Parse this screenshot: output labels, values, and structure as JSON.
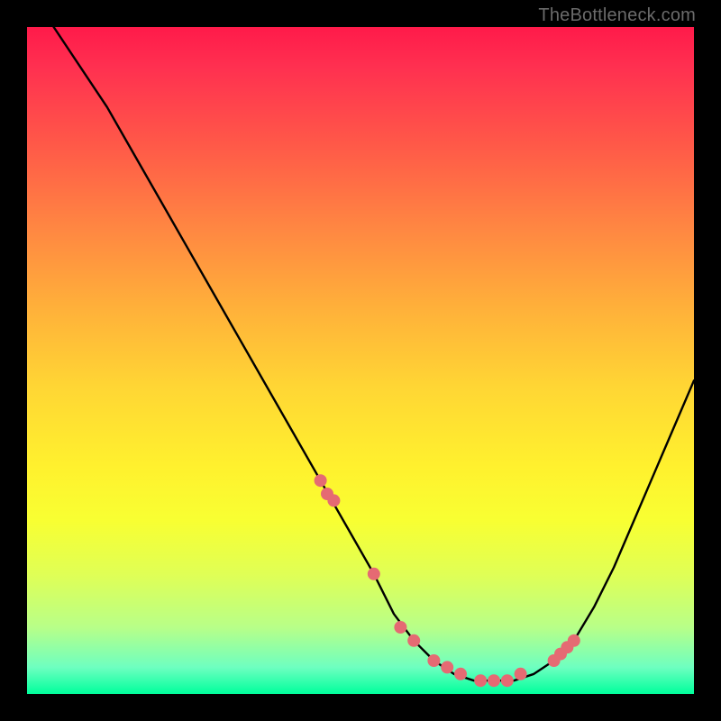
{
  "watermark": "TheBottleneck.com",
  "chart_data": {
    "type": "line",
    "title": "",
    "xlabel": "",
    "ylabel": "",
    "xlim": [
      0,
      100
    ],
    "ylim": [
      0,
      100
    ],
    "series": [
      {
        "name": "curve",
        "x": [
          4,
          8,
          12,
          16,
          20,
          24,
          28,
          32,
          36,
          40,
          44,
          48,
          52,
          55,
          58,
          61,
          64,
          67,
          70,
          73,
          76,
          79,
          82,
          85,
          88,
          91,
          94,
          97,
          100
        ],
        "values": [
          100,
          94,
          88,
          81,
          74,
          67,
          60,
          53,
          46,
          39,
          32,
          25,
          18,
          12,
          8,
          5,
          3,
          2,
          2,
          2,
          3,
          5,
          8,
          13,
          19,
          26,
          33,
          40,
          47
        ]
      }
    ],
    "markers": {
      "name": "dots",
      "color": "#e56a73",
      "x": [
        44,
        45,
        46,
        52,
        56,
        58,
        61,
        63,
        65,
        68,
        70,
        72,
        74,
        79,
        80,
        81,
        82
      ],
      "values": [
        32,
        30,
        29,
        18,
        10,
        8,
        5,
        4,
        3,
        2,
        2,
        2,
        3,
        5,
        6,
        7,
        8
      ]
    },
    "gradient_stops": [
      {
        "pct": 0,
        "color": "#ff1a4a"
      },
      {
        "pct": 18,
        "color": "#ff5a48"
      },
      {
        "pct": 42,
        "color": "#ffb03a"
      },
      {
        "pct": 66,
        "color": "#fff12e"
      },
      {
        "pct": 90,
        "color": "#b8ff88"
      },
      {
        "pct": 100,
        "color": "#00ff9c"
      }
    ]
  }
}
